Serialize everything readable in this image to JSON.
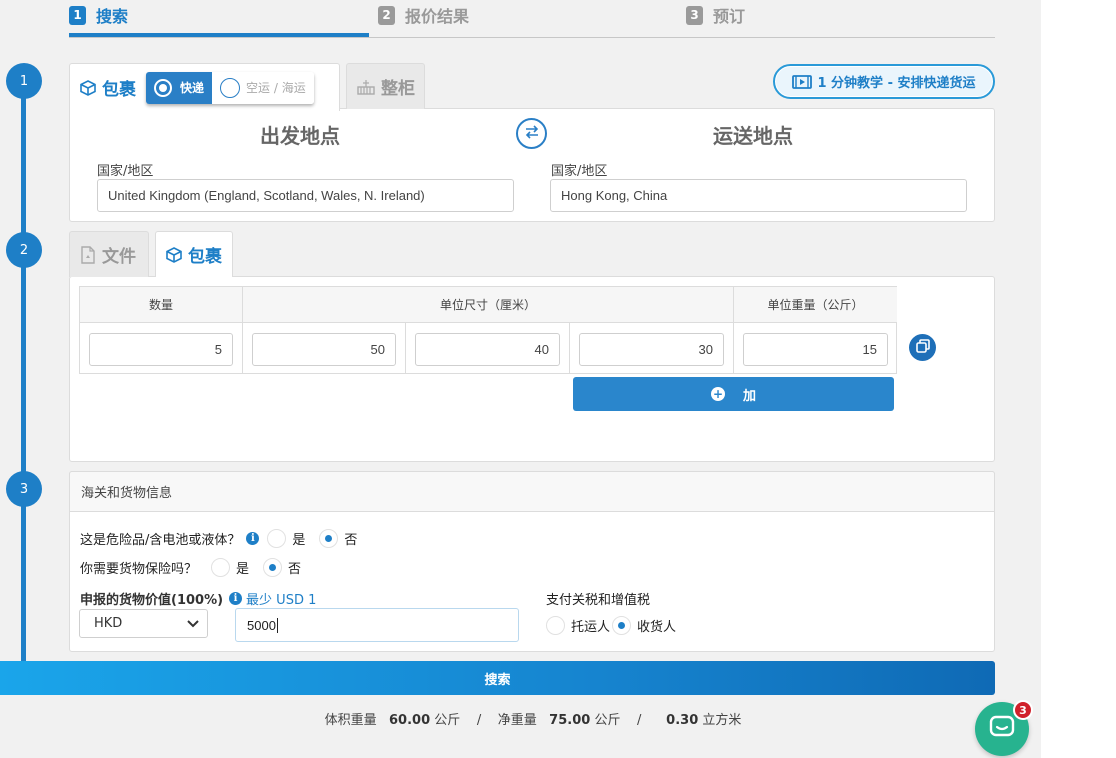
{
  "steps": [
    {
      "num": "1",
      "label": "搜索"
    },
    {
      "num": "2",
      "label": "报价结果"
    },
    {
      "num": "3",
      "label": "预订"
    }
  ],
  "timeline": [
    "1",
    "2",
    "3"
  ],
  "shipment": {
    "tab_parcel": "包裹",
    "mode_express": "快递",
    "mode_air_sea": "空运 / 海运",
    "tab_container": "整柜",
    "tutorial": "1 分钟教学 - 安排快递货运",
    "origin_heading": "出发地点",
    "destination_heading": "运送地点",
    "origin_label": "国家/地区",
    "origin_value": "United Kingdom (England, Scotland, Wales, N. Ireland)",
    "destination_label": "国家/地区",
    "destination_value": "Hong Kong, China"
  },
  "cargo": {
    "tab_documents": "文件",
    "tab_parcel": "包裹",
    "col_quantity": "数量",
    "col_dimensions": "单位尺寸（厘米）",
    "col_weight": "单位重量（公斤）",
    "quantity": "5",
    "length": "50",
    "width": "40",
    "height": "30",
    "weight": "15",
    "add_label": "加",
    "vol_weight_label": "体积重量",
    "vol_weight_value": "60.00",
    "unit_kg": "公斤",
    "net_weight_label": "净重量",
    "net_weight_value": "75.00",
    "volume_value": "0.30",
    "volume_unit": "立方米",
    "sep": "/"
  },
  "customs": {
    "heading": "海关和货物信息",
    "dangerous_q": "这是危险品/含电池或液体？",
    "insurance_q": "你需要货物保险吗？",
    "yes": "是",
    "no": "否",
    "declared_label": "申报的货物价值(100%)",
    "declared_min": "最少 USD 1",
    "currency": "HKD",
    "declared_value": "5000",
    "duty_label": "支付关税和增值税",
    "shipper": "托运人",
    "consignee": "收货人"
  },
  "search_label": "搜索",
  "chat": {
    "badge": "3"
  },
  "colors": {
    "accent": "#1e7fc7",
    "chat": "#27b38f",
    "badge": "#d0212b"
  }
}
